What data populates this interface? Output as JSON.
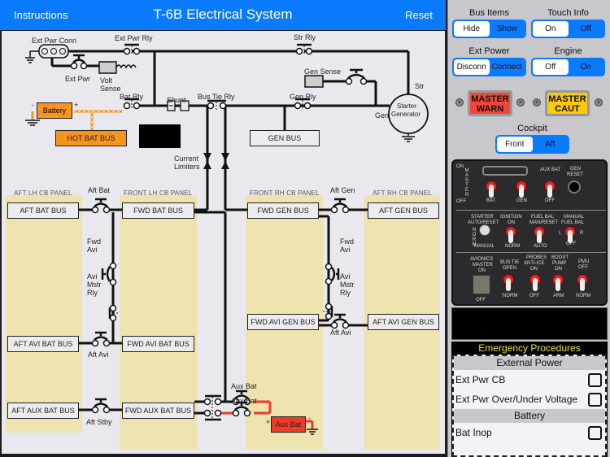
{
  "header": {
    "left_button": "Instructions",
    "title": "T-6B Electrical System",
    "right_button": "Reset",
    "color": "#0a7aff"
  },
  "diagram": {
    "labels": {
      "ext_pwr_conn": "Ext Pwr Conn",
      "ext_pwr_rly": "Ext Pwr Rly",
      "ext_pwr": "Ext Pwr",
      "volt_sense_1": "Volt",
      "volt_sense_2": "Sense",
      "str_rly": "Str Rly",
      "gen_sense": "Gen Sense",
      "bat_rly": "Bat Rly",
      "shunt": "Shunt",
      "bus_tie_rly": "Bus Tie Rly",
      "gen_rly": "Gen Rly",
      "str": "Str",
      "gen": "Gen",
      "starter_generator_1": "Starter",
      "starter_generator_2": "Generator",
      "battery": "Battery",
      "battery_plus": "+",
      "battery_minus": "-",
      "current_limiters_1": "Current",
      "current_limiters_2": "Limiters",
      "aft_bat": "Aft Bat",
      "aft_gen": "Aft Gen",
      "fwd_avi_l_1": "Fwd",
      "fwd_avi_l_2": "Avi",
      "avi_mstr_rly_l_1": "Avi",
      "avi_mstr_rly_l_2": "Mstr",
      "avi_mstr_rly_l_3": "Rly",
      "fwd_avi_r_1": "Fwd",
      "fwd_avi_r_2": "Avi",
      "avi_mstr_rly_r_1": "Avi",
      "avi_mstr_rly_r_2": "Mstr",
      "avi_mstr_rly_r_3": "Rly",
      "aft_avi_l": "Aft Avi",
      "aft_avi_r": "Aft Avi",
      "aft_stby": "Aft Stby",
      "aux_bat_1": "Aux Bat",
      "aux_bat_2": "Aux Bat",
      "aux_bat_plus": "+",
      "aux_bat_minus": "-"
    },
    "panels": {
      "aft_lh": "AFT LH CB PANEL",
      "front_lh": "FRONT LH CB PANEL",
      "front_rh": "FRONT RH CB PANEL",
      "aft_rh": "AFT RH CB PANEL"
    },
    "buses": {
      "hot_bat": "HOT BAT BUS",
      "gen": "GEN BUS",
      "aft_bat": "AFT BAT BUS",
      "fwd_bat": "FWD BAT BUS",
      "fwd_gen": "FWD GEN BUS",
      "aft_gen": "AFT GEN BUS",
      "aft_avi_bat": "AFT AVI BAT BUS",
      "fwd_avi_bat": "FWD AVI BAT BUS",
      "fwd_avi_gen": "FWD AVI GEN BUS",
      "aft_avi_gen": "AFT AVI GEN BUS",
      "aft_aux_bat": "AFT AUX BAT BUS",
      "fwd_aux_bat": "FWD AUX BAT BUS",
      "aux_bat_box": "Aux Bat"
    },
    "colors": {
      "battery": "#f7941d",
      "aux_bat": "#ef3b2c",
      "cb_panel": "#ede3ae",
      "wire": "#111111"
    }
  },
  "side": {
    "bus_items": {
      "title": "Bus Items",
      "options": [
        "Hide",
        "Show"
      ],
      "selected": "Hide"
    },
    "touch_info": {
      "title": "Touch Info",
      "options": [
        "On",
        "Off"
      ],
      "selected": "On"
    },
    "ext_power": {
      "title": "Ext Power",
      "options": [
        "Disconn",
        "Connect"
      ],
      "selected": "Disconn"
    },
    "engine": {
      "title": "Engine",
      "options": [
        "Off",
        "On"
      ],
      "selected": "Off"
    },
    "master_warn": {
      "line1": "MASTER",
      "line2": "WARN",
      "color": "#f4453a"
    },
    "master_caut": {
      "line1": "MASTER",
      "line2": "CAUT",
      "color": "#fcc70f"
    },
    "cockpit": {
      "title": "Cockpit",
      "options": [
        "Front",
        "Aft"
      ],
      "selected": "Front"
    },
    "cockpit_panel": {
      "on": "ON",
      "master": "MASTER",
      "off": "OFF",
      "bat": "BAT",
      "gen": "GEN",
      "aux_bat": "AUX BAT",
      "aux_off": "OFF",
      "gen_reset_1": "GEN",
      "gen_reset_2": "RESET",
      "starter_1": "STARTER",
      "starter_2": "AUTO/RESET",
      "starter_norm": "NORM",
      "starter_manual": "MANUAL",
      "ignition_1": "IGNITION",
      "ignition_2": "ON",
      "ignition_norm": "NORM",
      "fuel_bal_1": "FUEL BAL",
      "fuel_bal_2": "MAN/RESET",
      "fuel_auto": "AUTO",
      "man_fuel_1": "MANUAL",
      "man_fuel_2": "FUEL BAL",
      "man_l": "L",
      "man_r": "R",
      "man_off": "OFF",
      "avionics_1": "AVIONICS",
      "avionics_2": "MASTER",
      "avionics_3": "ON",
      "avionics_off": "OFF",
      "bus_tie_1": "BUS TIE",
      "bus_tie_2": "OPEN",
      "bus_tie_norm": "NORM",
      "probes_1": "PROBES",
      "probes_2": "ANTI-ICE",
      "probes_3": "ON",
      "probes_off": "OFF",
      "boost_1": "BOOST",
      "boost_2": "PUMP",
      "boost_3": "ON",
      "boost_arm": "ARM",
      "pmu_1": "PMU",
      "pmu_2": "OFF",
      "pmu_norm": "NORM"
    },
    "emergency": {
      "title": "Emergency Procedures",
      "sections": [
        {
          "title": "External Power",
          "items": [
            "Ext Pwr CB",
            "Ext Pwr Over/Under Voltage"
          ]
        },
        {
          "title": "Battery",
          "items": [
            "Bat Inop"
          ]
        }
      ]
    }
  }
}
